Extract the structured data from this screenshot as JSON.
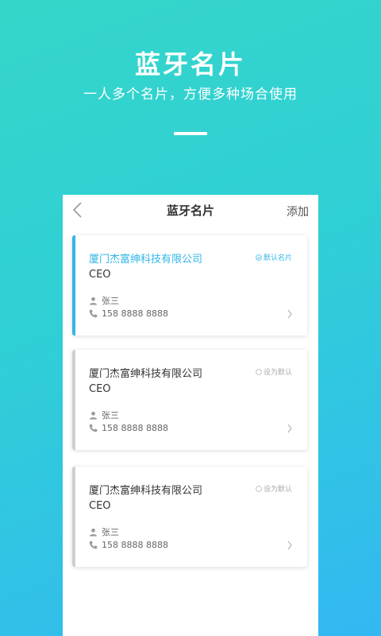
{
  "hero": {
    "title": "蓝牙名片",
    "subtitle": "一人多个名片，方便多种场合使用"
  },
  "app": {
    "title": "蓝牙名片",
    "add_label": "添加",
    "back_icon": "chevron-left-icon"
  },
  "cards": [
    {
      "company": "厦门杰富绅科技有限公司",
      "position": "CEO",
      "tag": "默认名片",
      "name": "张三",
      "phone": "158 8888 8888",
      "is_default": true
    },
    {
      "company": "厦门杰富绅科技有限公司",
      "position": "CEO",
      "tag": "设为默认",
      "name": "张三",
      "phone": "158 8888 8888",
      "is_default": false
    },
    {
      "company": "厦门杰富绅科技有限公司",
      "position": "CEO",
      "tag": "设为默认",
      "name": "张三",
      "phone": "158 8888 8888",
      "is_default": false
    }
  ],
  "colors": {
    "accent": "#32b6e8",
    "inactive_bar": "#cfcfcf",
    "gradient_start": "#35d6c9",
    "gradient_end": "#33b8f2"
  }
}
